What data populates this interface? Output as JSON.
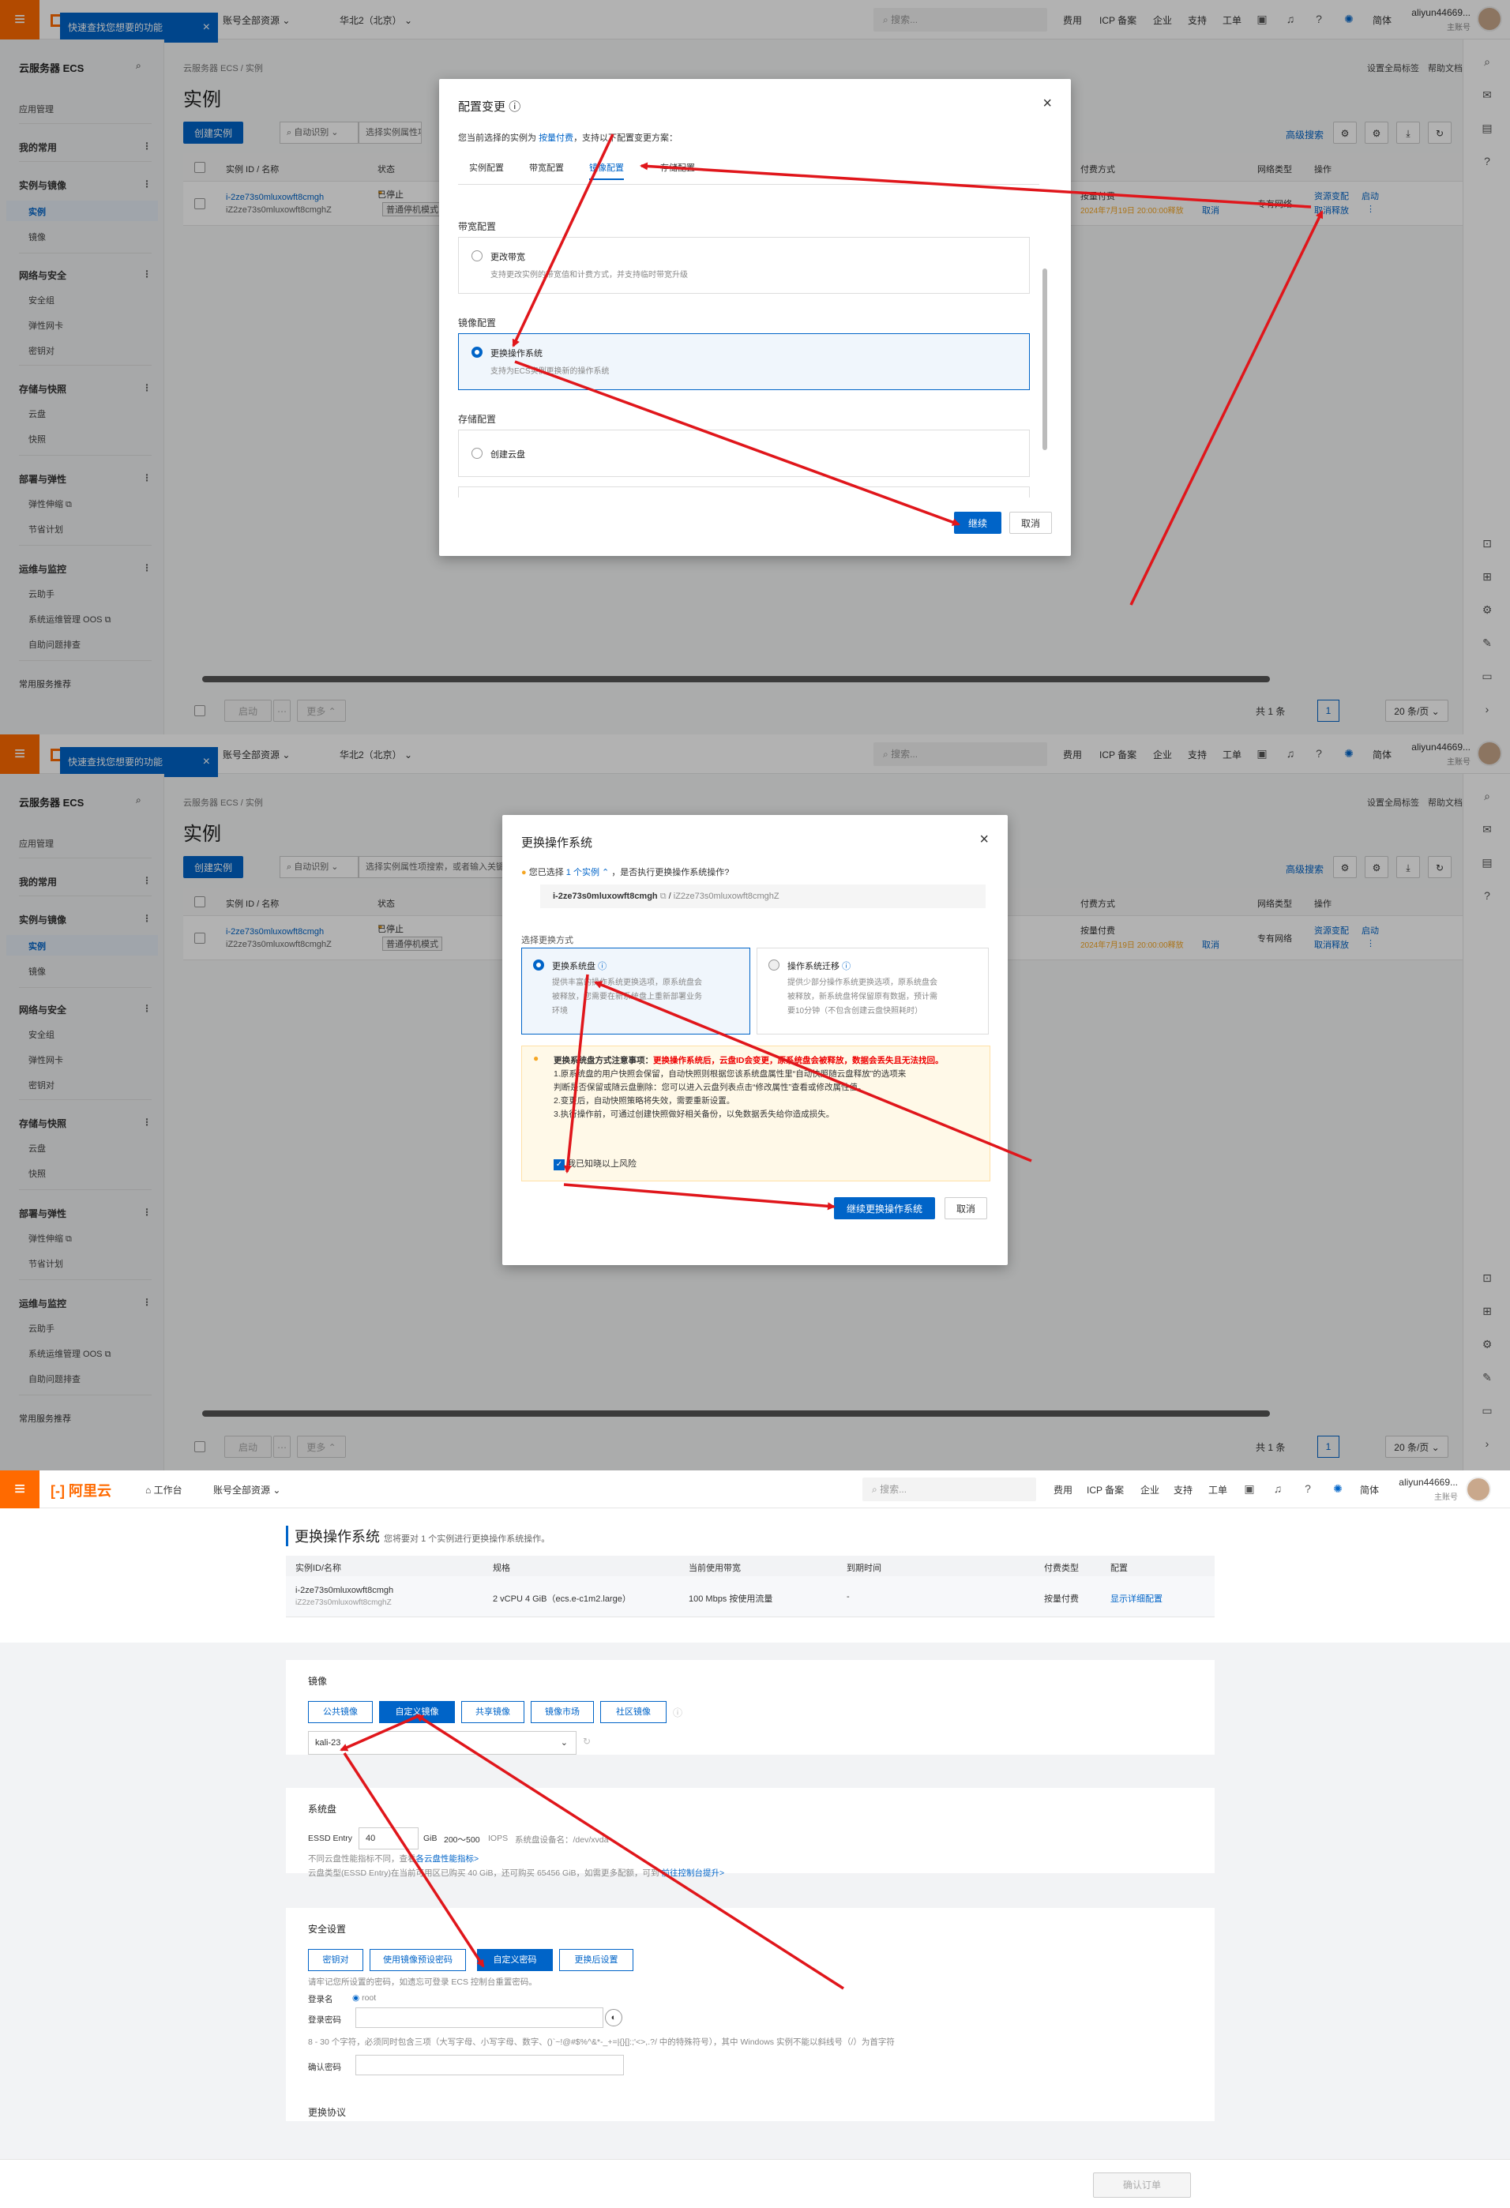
{
  "colors": {
    "accent": "#0064c8",
    "brand": "#ff6a00",
    "arrow": "#e0161b",
    "warning": "#f5a623"
  },
  "topbar": {
    "logo": "阿里云",
    "workbench": "工作台",
    "account_scope": "账号全部资源",
    "region": "华北2（北京）",
    "search_placeholder": "搜索...",
    "links": [
      "费用",
      "ICP 备案",
      "企业",
      "支持",
      "工单"
    ],
    "lang": "简体",
    "username": "aliyun44669...",
    "role": "主账号"
  },
  "tooltip": {
    "text": "快速查找您想要的功能"
  },
  "sidebar": {
    "title": "云服务器 ECS",
    "app_mgmt": "应用管理",
    "my_common": "我的常用",
    "groups": [
      {
        "label": "实例与镜像",
        "items": [
          "实例",
          "镜像"
        ]
      },
      {
        "label": "网络与安全",
        "items": [
          "安全组",
          "弹性网卡",
          "密钥对"
        ]
      },
      {
        "label": "存储与快照",
        "items": [
          "云盘",
          "快照"
        ]
      },
      {
        "label": "部署与弹性",
        "items": [
          "弹性伸缩",
          "节省计划"
        ]
      },
      {
        "label": "运维与监控",
        "items": [
          "云助手",
          "系统运维管理 OOS",
          "自助问题排查"
        ]
      }
    ],
    "recommend": "常用服务推荐"
  },
  "instances_page": {
    "breadcrumb": "云服务器 ECS / 实例",
    "title": "实例",
    "global_tags": "设置全局标签",
    "help": "帮助文档",
    "create_btn": "创建实例",
    "auto_detect": "自动识别",
    "filter_placeholder": "选择实例属性项搜索，或者输入关键字识别搜索",
    "advanced_search": "高级搜索",
    "columns": [
      "实例 ID / 名称",
      "状态",
      "付费方式",
      "网络类型",
      "操作"
    ],
    "row": {
      "id": "i-2ze73s0mluxowft8cmgh",
      "name": "iZ2ze73s0mluxowft8cmghZ",
      "status": "已停止",
      "tag": "普通停机模式",
      "pay": "按量付费",
      "release": "2024年7月19日 20:00:00释放",
      "cancel": "取消",
      "network": "专有网络",
      "op_change": "资源变配",
      "op_start": "启动",
      "op_release": "取消释放",
      "op_more": "⋮"
    },
    "footer": {
      "start": "启动",
      "more": "更多",
      "total": "共 1 条",
      "page": "1",
      "page_size": "20 条/页"
    }
  },
  "config_modal": {
    "title": "配置变更",
    "intro_prefix": "您当前选择的实例为",
    "intro_link": "按量付费",
    "intro_suffix": "，支持以下配置变更方案：",
    "tabs": [
      "实例配置",
      "带宽配置",
      "镜像配置",
      "存储配置"
    ],
    "bandwidth_title": "带宽配置",
    "bandwidth_opt": "更改带宽",
    "bandwidth_desc": "支持更改实例的带宽值和计费方式，并支持临时带宽升级",
    "image_title": "镜像配置",
    "image_opt": "更换操作系统",
    "image_desc": "支持为ECS实例更换新的操作系统",
    "storage_title": "存储配置",
    "storage_opt": "创建云盘",
    "continue": "继续",
    "cancel": "取消"
  },
  "os_modal": {
    "title": "更换操作系统",
    "selected_prefix": "您已选择",
    "selected_link": "1 个实例",
    "selected_suffix": "，是否执行更换操作系统操作?",
    "instance_id": "i-2ze73s0mluxowft8cmgh",
    "instance_name": "iZ2ze73s0mluxowft8cmghZ",
    "mode_label": "选择更换方式",
    "mode1": "更换系统盘",
    "mode1_desc": [
      "提供丰富的操作系统更换选项，原系统盘会",
      "被释放，您需要在新系统盘上重新部署业务",
      "环境"
    ],
    "mode2": "操作系统迁移",
    "mode2_desc": [
      "提供少部分操作系统更换选项，原系统盘会",
      "被释放，新系统盘将保留原有数据，预计需",
      "要10分钟（不包含创建云盘快照耗时）"
    ],
    "warn_title": "更换系统盘方式注意事项：",
    "warn_red": "更换操作系统后，云盘ID会变更，原系统盘会被释放，数据会丢失且无法找回。",
    "warn_lines": [
      "1.原系统盘的用户快照会保留，自动快照则根据您该系统盘属性里“自动快照随云盘释放”的选项来",
      "判断是否保留或随云盘删除：您可以进入云盘列表点击“修改属性”查看或修改属性值。",
      "2.变更后，自动快照策略将失效，需要重新设置。",
      "3.执行操作前，可通过创建快照做好相关备份，以免数据丢失给你造成损失。"
    ],
    "ack": "我已知晓以上风险",
    "continue": "继续更换操作系统",
    "cancel": "取消"
  },
  "replace_page": {
    "title": "更换操作系统",
    "subtitle": "您将要对 1 个实例进行更换操作系统操作。",
    "columns": [
      "实例ID/名称",
      "规格",
      "当前使用带宽",
      "到期时间",
      "付费类型",
      "配置"
    ],
    "row": {
      "id": "i-2ze73s0mluxowft8cmgh",
      "name": "iZ2ze73s0mluxowft8cmghZ",
      "spec": "2 vCPU 4 GiB（ecs.e-c1m2.large）",
      "bandwidth": "100 Mbps 按使用流量",
      "expire": "-",
      "pay": "按量付费",
      "config": "显示详细配置"
    },
    "image_title": "镜像",
    "image_tabs": [
      "公共镜像",
      "自定义镜像",
      "共享镜像",
      "镜像市场",
      "社区镜像"
    ],
    "image_value": "kali-23",
    "disk_title": "系统盘",
    "disk_type": "ESSD Entry",
    "disk_size": "40",
    "disk_unit": "GiB",
    "disk_iops": "200～500",
    "iops_unit": "IOPS",
    "disk_device": "系统盘设备名：/dev/xvda",
    "disk_note1_a": "不同云盘性能指标不同，查看",
    "disk_note1_link": "各云盘性能指标>",
    "disk_note2_a": "云盘类型(ESSD Entry)在当前可用区已购买 40 GiB，还可购买 65456 GiB，如需更多配额，可到",
    "disk_note2_link": "前往控制台提升>",
    "security_title": "安全设置",
    "security_tabs": [
      "密钥对",
      "使用镜像预设密码",
      "自定义密码",
      "更换后设置"
    ],
    "security_note": "请牢记您所设置的密码，如遗忘可登录 ECS 控制台重置密码。",
    "login_name_label": "登录名",
    "login_name": "root",
    "password_label": "登录密码",
    "password_rule": "8 - 30 个字符，必须同时包含三项（大写字母、小写字母、数字、()`~!@#$%^&*-_+=|{}[]:;'<>,.?/ 中的特殊符号），其中 Windows 实例不能以斜线号（/）为首字符",
    "confirm_label": "确认密码",
    "confirm_order": "确认订单",
    "partial_title": "更换协议"
  }
}
